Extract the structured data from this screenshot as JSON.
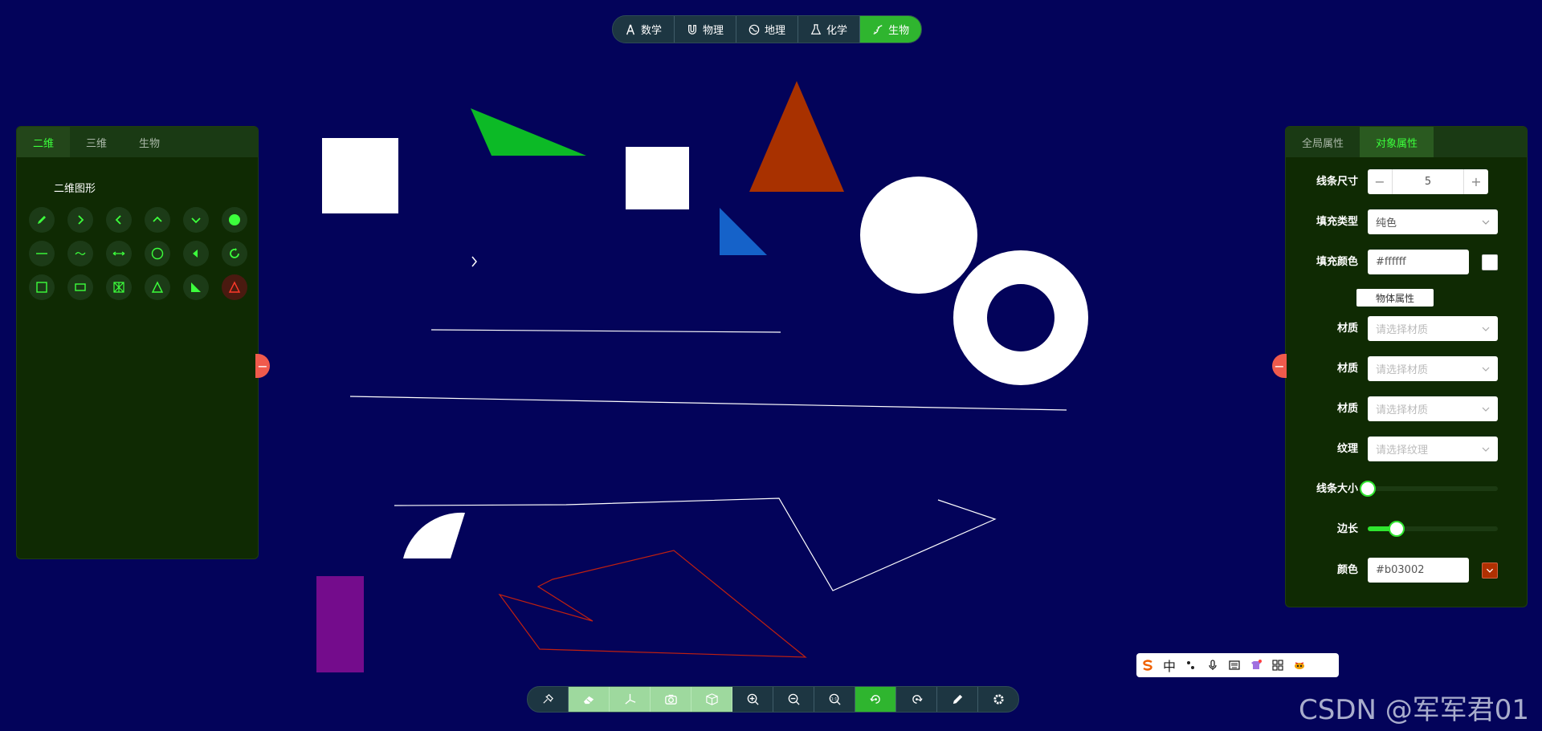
{
  "subjects": [
    {
      "label": "数学",
      "icon": "compass-icon"
    },
    {
      "label": "物理",
      "icon": "magnet-icon"
    },
    {
      "label": "地理",
      "icon": "globe-icon"
    },
    {
      "label": "化学",
      "icon": "flask-icon"
    },
    {
      "label": "生物",
      "icon": "dna-icon",
      "active": true
    }
  ],
  "left_panel": {
    "tabs": [
      "二维",
      "三维",
      "生物"
    ],
    "active_tab": "二维",
    "section_title": "二维图形",
    "tools": [
      "pencil-icon",
      "chevron-right-icon",
      "chevron-left-icon",
      "chevron-up-icon",
      "chevron-down-icon",
      "filled-circle-icon",
      "line-icon",
      "curve-icon",
      "double-arrow-line-icon",
      "circle-icon",
      "sector-icon",
      "ring-icon",
      "square-icon",
      "rectangle-icon",
      "polygon-icon",
      "triangle-icon",
      "right-triangle-icon",
      "warning-triangle-icon"
    ]
  },
  "right_panel": {
    "tabs": [
      "全局属性",
      "对象属性"
    ],
    "active_tab": "对象属性",
    "line_size": {
      "label": "线条尺寸",
      "value": "5",
      "minus": "−",
      "plus": "+"
    },
    "fill_type": {
      "label": "填充类型",
      "value": "纯色"
    },
    "fill_color": {
      "label": "填充颜色",
      "value": "#ffffff",
      "swatch": "#ffffff"
    },
    "object_props_label": "物体属性",
    "materials": [
      {
        "label": "材质",
        "placeholder": "请选择材质"
      },
      {
        "label": "材质",
        "placeholder": "请选择材质"
      },
      {
        "label": "材质",
        "placeholder": "请选择材质"
      },
      {
        "label": "纹理",
        "placeholder": "请选择纹理"
      }
    ],
    "line_width_slider": {
      "label": "线条大小",
      "fraction": 0.0
    },
    "edge_slider": {
      "label": "边长",
      "fraction": 0.22
    },
    "color": {
      "label": "颜色",
      "value": "#b03002",
      "swatch": "#b03002"
    }
  },
  "canvas_colors": {
    "white": "#ffffff",
    "green": "#0cba26",
    "blue": "#1562c9",
    "red": "#a83100",
    "purple": "#740c8c",
    "polyline_red": "#c02010"
  },
  "toolbar": [
    "brush-erase-icon",
    "eraser-icon",
    "axes-icon",
    "camera-icon",
    "cube-icon",
    "zoom-in-icon",
    "zoom-out-icon",
    "zoom-reset-icon",
    "rotate-icon",
    "redo-rotate-icon",
    "pen-icon",
    "settings-icon"
  ],
  "ime_bar": [
    "sogou-logo-icon",
    "中",
    "punctuation-icon",
    "microphone-icon",
    "keyboard-icon",
    "skin-icon",
    "grid-icon",
    "more-icon"
  ],
  "watermark": "CSDN @军军君01"
}
